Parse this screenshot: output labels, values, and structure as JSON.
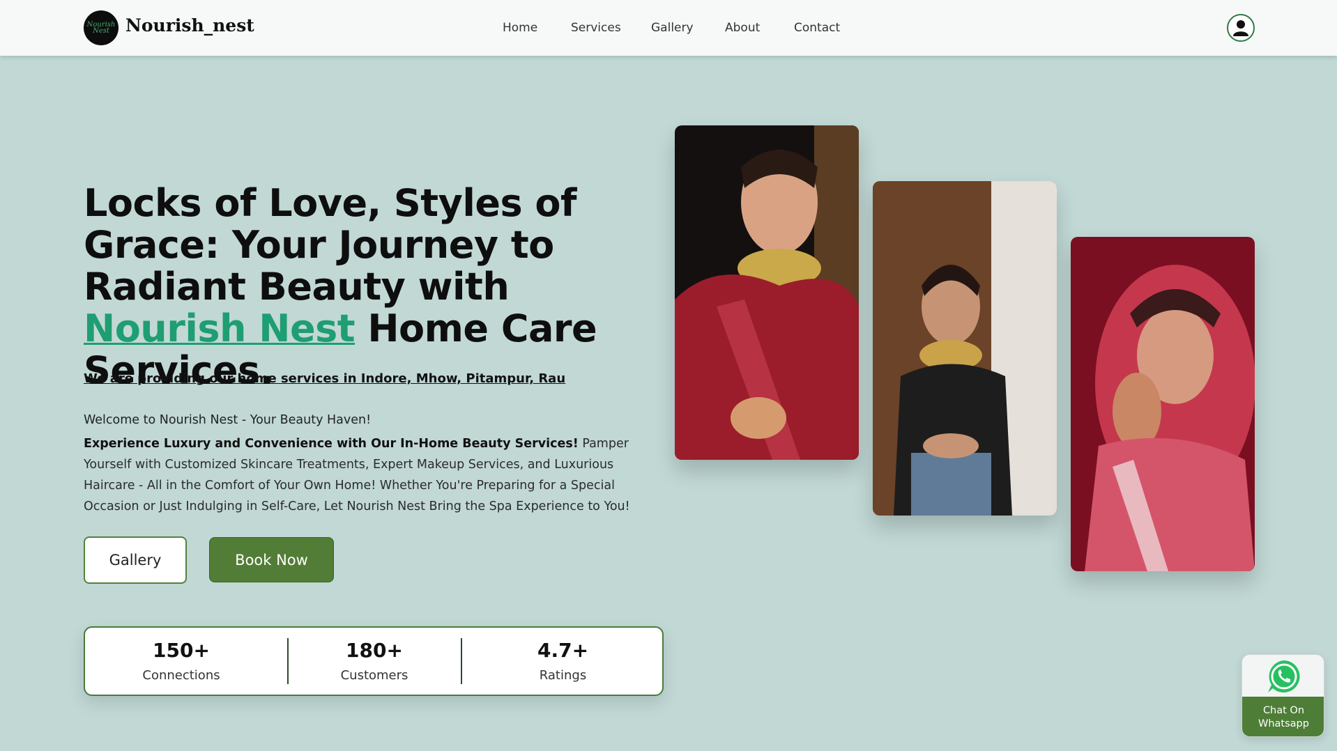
{
  "brand": {
    "name": "Nourish_nest",
    "logo_text": "Nourish Nest"
  },
  "nav": {
    "items": [
      "Home",
      "Services",
      "Gallery",
      "About",
      "Contact"
    ]
  },
  "hero": {
    "title_part1": "Locks of Love, Styles of Grace: Your Journey to Radiant Beauty with ",
    "title_accent": "Nourish Nest",
    "title_part2": " Home Care Services.",
    "subtitle": "We are providing our home services in Indore, Mhow, Pitampur, Rau",
    "welcome": "Welcome to Nourish Nest - Your Beauty Haven!",
    "desc_bold": "Experience Luxury and Convenience with Our In-Home Beauty Services!",
    "desc_rest": " Pamper Yourself with Customized Skincare Treatments, Expert Makeup Services, and Luxurious Haircare - All in the Comfort of Your Own Home! Whether You're Preparing for a Special Occasion or Just Indulging in Self-Care, Let Nourish Nest Bring the Spa Experience to You!",
    "btn_gallery": "Gallery",
    "btn_book": "Book Now"
  },
  "stats": [
    {
      "value": "150+",
      "label": "Connections"
    },
    {
      "value": "180+",
      "label": "Customers"
    },
    {
      "value": "4.7+",
      "label": "Ratings"
    }
  ],
  "whatsapp": {
    "line1": "Chat On",
    "line2": "Whatsapp"
  },
  "colors": {
    "accent": "#1e9e72",
    "primary": "#527d37",
    "background": "#c1d8d5"
  },
  "icons": {
    "profile": "user-circle-icon",
    "whatsapp": "whatsapp-icon"
  }
}
